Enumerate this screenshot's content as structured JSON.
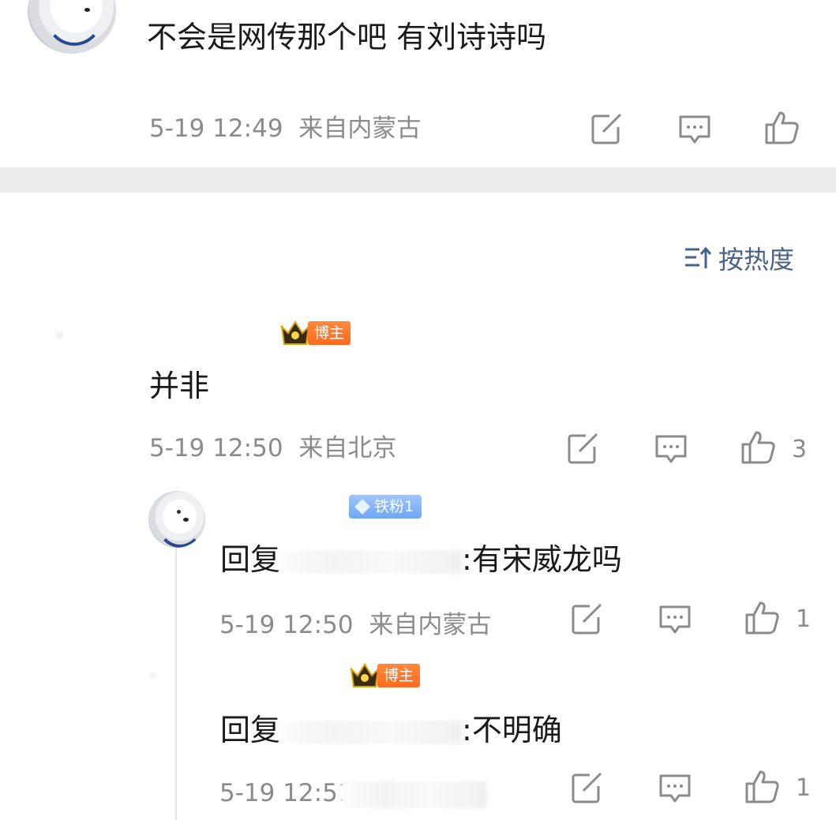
{
  "top_comment": {
    "text": "不会是网传那个吧 有刘诗诗吗",
    "time": "5-19 12:49",
    "location": "来自内蒙古"
  },
  "sort": {
    "label": "按热度",
    "icon": "sort-icon"
  },
  "comment_main": {
    "badge": "博主",
    "text": "并非",
    "time": "5-19 12:50",
    "location": "来自北京",
    "likes": "3"
  },
  "replies": [
    {
      "badge": "铁粉1",
      "prefix": "回复",
      "text": ":有宋威龙吗",
      "time": "5-19 12:50",
      "location": "来自内蒙古",
      "likes": "1"
    },
    {
      "badge": "博主",
      "prefix": "回复",
      "text": ":不明确",
      "time": "5-19 12:51",
      "likes": "1"
    }
  ],
  "colors": {
    "accent_blue": "#4a6288",
    "meta_gray": "#8b8b8b",
    "divider": "#ececec",
    "badge_orange": "#ff7a2a",
    "fan_blue": "#7fb2f8"
  }
}
